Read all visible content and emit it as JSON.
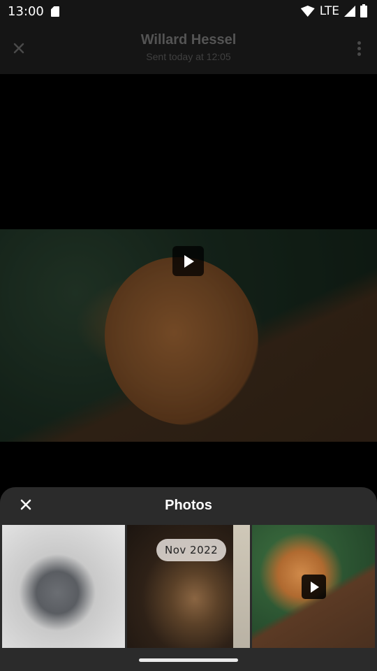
{
  "status_bar": {
    "time": "13:00",
    "network": "LTE"
  },
  "header": {
    "sender_name": "Willard Hessel",
    "sent_time": "Sent today at 12:05"
  },
  "viewer": {
    "media_type": "video"
  },
  "photos_sheet": {
    "title": "Photos",
    "date_chip": "Nov 2022",
    "thumbnails": [
      {
        "type": "photo"
      },
      {
        "type": "photo"
      },
      {
        "type": "video"
      }
    ]
  },
  "colors": {
    "background": "#000000",
    "sheet": "#2b2b2b",
    "header_text": "#545454"
  }
}
